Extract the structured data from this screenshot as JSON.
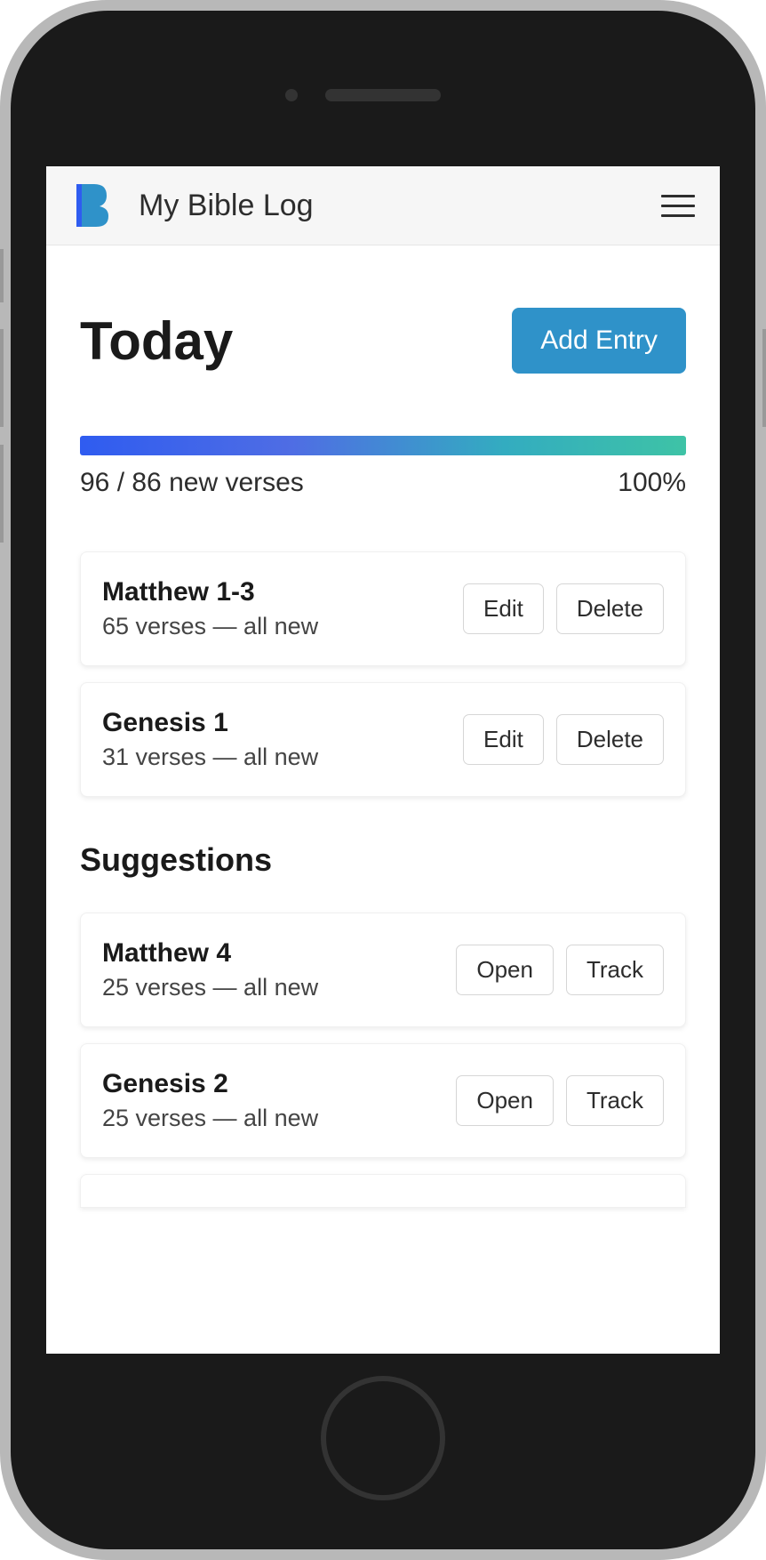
{
  "app": {
    "title": "My Bible Log"
  },
  "page": {
    "title": "Today",
    "add_entry_label": "Add Entry"
  },
  "progress": {
    "text": "96 / 86 new verses",
    "percent": "100%"
  },
  "entries": [
    {
      "title": "Matthew 1-3",
      "meta": "65 verses — all new",
      "action1": "Edit",
      "action2": "Delete"
    },
    {
      "title": "Genesis 1",
      "meta": "31 verses — all new",
      "action1": "Edit",
      "action2": "Delete"
    }
  ],
  "suggestions_title": "Suggestions",
  "suggestions": [
    {
      "title": "Matthew 4",
      "meta": "25 verses — all new",
      "action1": "Open",
      "action2": "Track"
    },
    {
      "title": "Genesis 2",
      "meta": "25 verses — all new",
      "action1": "Open",
      "action2": "Track"
    }
  ]
}
